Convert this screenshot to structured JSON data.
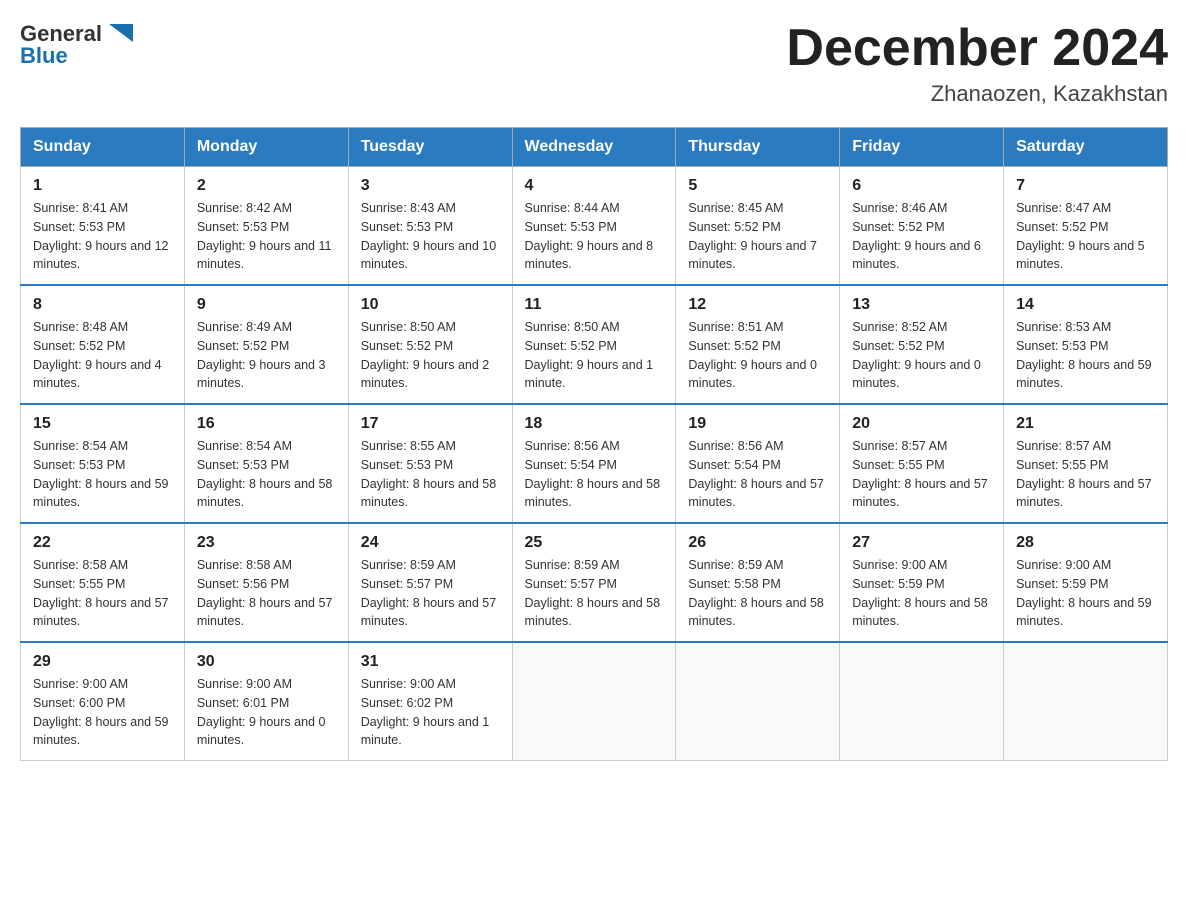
{
  "header": {
    "logo_line1": "General",
    "logo_line2": "Blue",
    "month_title": "December 2024",
    "location": "Zhanaozen, Kazakhstan"
  },
  "weekdays": [
    "Sunday",
    "Monday",
    "Tuesday",
    "Wednesday",
    "Thursday",
    "Friday",
    "Saturday"
  ],
  "weeks": [
    [
      {
        "day": "1",
        "sunrise": "8:41 AM",
        "sunset": "5:53 PM",
        "daylight": "9 hours and 12 minutes."
      },
      {
        "day": "2",
        "sunrise": "8:42 AM",
        "sunset": "5:53 PM",
        "daylight": "9 hours and 11 minutes."
      },
      {
        "day": "3",
        "sunrise": "8:43 AM",
        "sunset": "5:53 PM",
        "daylight": "9 hours and 10 minutes."
      },
      {
        "day": "4",
        "sunrise": "8:44 AM",
        "sunset": "5:53 PM",
        "daylight": "9 hours and 8 minutes."
      },
      {
        "day": "5",
        "sunrise": "8:45 AM",
        "sunset": "5:52 PM",
        "daylight": "9 hours and 7 minutes."
      },
      {
        "day": "6",
        "sunrise": "8:46 AM",
        "sunset": "5:52 PM",
        "daylight": "9 hours and 6 minutes."
      },
      {
        "day": "7",
        "sunrise": "8:47 AM",
        "sunset": "5:52 PM",
        "daylight": "9 hours and 5 minutes."
      }
    ],
    [
      {
        "day": "8",
        "sunrise": "8:48 AM",
        "sunset": "5:52 PM",
        "daylight": "9 hours and 4 minutes."
      },
      {
        "day": "9",
        "sunrise": "8:49 AM",
        "sunset": "5:52 PM",
        "daylight": "9 hours and 3 minutes."
      },
      {
        "day": "10",
        "sunrise": "8:50 AM",
        "sunset": "5:52 PM",
        "daylight": "9 hours and 2 minutes."
      },
      {
        "day": "11",
        "sunrise": "8:50 AM",
        "sunset": "5:52 PM",
        "daylight": "9 hours and 1 minute."
      },
      {
        "day": "12",
        "sunrise": "8:51 AM",
        "sunset": "5:52 PM",
        "daylight": "9 hours and 0 minutes."
      },
      {
        "day": "13",
        "sunrise": "8:52 AM",
        "sunset": "5:52 PM",
        "daylight": "9 hours and 0 minutes."
      },
      {
        "day": "14",
        "sunrise": "8:53 AM",
        "sunset": "5:53 PM",
        "daylight": "8 hours and 59 minutes."
      }
    ],
    [
      {
        "day": "15",
        "sunrise": "8:54 AM",
        "sunset": "5:53 PM",
        "daylight": "8 hours and 59 minutes."
      },
      {
        "day": "16",
        "sunrise": "8:54 AM",
        "sunset": "5:53 PM",
        "daylight": "8 hours and 58 minutes."
      },
      {
        "day": "17",
        "sunrise": "8:55 AM",
        "sunset": "5:53 PM",
        "daylight": "8 hours and 58 minutes."
      },
      {
        "day": "18",
        "sunrise": "8:56 AM",
        "sunset": "5:54 PM",
        "daylight": "8 hours and 58 minutes."
      },
      {
        "day": "19",
        "sunrise": "8:56 AM",
        "sunset": "5:54 PM",
        "daylight": "8 hours and 57 minutes."
      },
      {
        "day": "20",
        "sunrise": "8:57 AM",
        "sunset": "5:55 PM",
        "daylight": "8 hours and 57 minutes."
      },
      {
        "day": "21",
        "sunrise": "8:57 AM",
        "sunset": "5:55 PM",
        "daylight": "8 hours and 57 minutes."
      }
    ],
    [
      {
        "day": "22",
        "sunrise": "8:58 AM",
        "sunset": "5:55 PM",
        "daylight": "8 hours and 57 minutes."
      },
      {
        "day": "23",
        "sunrise": "8:58 AM",
        "sunset": "5:56 PM",
        "daylight": "8 hours and 57 minutes."
      },
      {
        "day": "24",
        "sunrise": "8:59 AM",
        "sunset": "5:57 PM",
        "daylight": "8 hours and 57 minutes."
      },
      {
        "day": "25",
        "sunrise": "8:59 AM",
        "sunset": "5:57 PM",
        "daylight": "8 hours and 58 minutes."
      },
      {
        "day": "26",
        "sunrise": "8:59 AM",
        "sunset": "5:58 PM",
        "daylight": "8 hours and 58 minutes."
      },
      {
        "day": "27",
        "sunrise": "9:00 AM",
        "sunset": "5:59 PM",
        "daylight": "8 hours and 58 minutes."
      },
      {
        "day": "28",
        "sunrise": "9:00 AM",
        "sunset": "5:59 PM",
        "daylight": "8 hours and 59 minutes."
      }
    ],
    [
      {
        "day": "29",
        "sunrise": "9:00 AM",
        "sunset": "6:00 PM",
        "daylight": "8 hours and 59 minutes."
      },
      {
        "day": "30",
        "sunrise": "9:00 AM",
        "sunset": "6:01 PM",
        "daylight": "9 hours and 0 minutes."
      },
      {
        "day": "31",
        "sunrise": "9:00 AM",
        "sunset": "6:02 PM",
        "daylight": "9 hours and 1 minute."
      },
      null,
      null,
      null,
      null
    ]
  ]
}
